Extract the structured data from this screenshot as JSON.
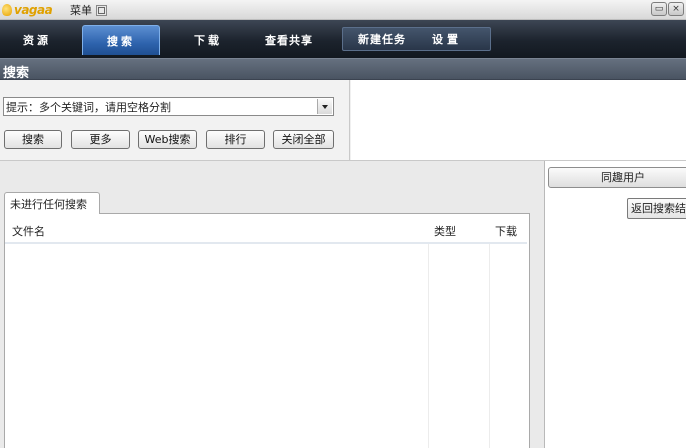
{
  "titlebar": {
    "logo_text": "vagaa",
    "menu_label": "菜单",
    "icons": [
      "restore-icon",
      "close-icon"
    ]
  },
  "nav": {
    "tabs": [
      "资源",
      "搜索",
      "下载",
      "查看共享"
    ],
    "active_tab": "搜索",
    "group_tabs": [
      "新建任务",
      "设置"
    ]
  },
  "search": {
    "section_title": "搜索",
    "input_value": "提示：多个关键词，请用空格分割",
    "buttons": [
      "搜索",
      "更多",
      "Web搜索",
      "排行",
      "关闭全部"
    ]
  },
  "results": {
    "tab_label": "未进行任何搜索",
    "columns": [
      "文件名",
      "类型",
      "下载"
    ],
    "rows": []
  },
  "side": {
    "header": "同趣用户",
    "back_button": "返回搜索结"
  },
  "colors": {
    "nav_bg": "#1c232d",
    "active_tab": "#2e63ad",
    "section_bg": "#5a6472",
    "logo": "#e0a100"
  }
}
